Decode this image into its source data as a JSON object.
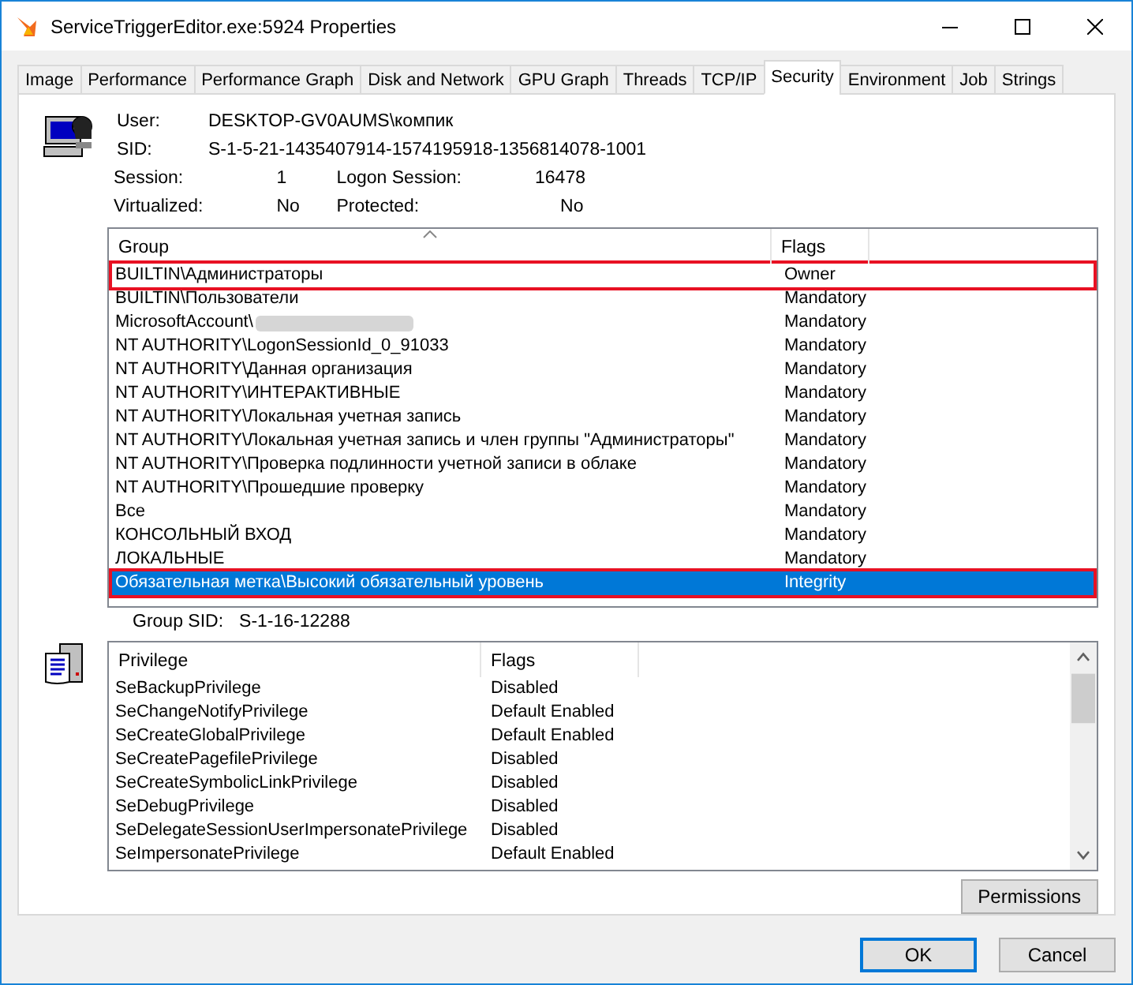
{
  "window": {
    "title": "ServiceTriggerEditor.exe:5924 Properties"
  },
  "tabs": [
    {
      "label": "Image",
      "selected": false
    },
    {
      "label": "Performance",
      "selected": false
    },
    {
      "label": "Performance Graph",
      "selected": false
    },
    {
      "label": "Disk and Network",
      "selected": false
    },
    {
      "label": "GPU Graph",
      "selected": false
    },
    {
      "label": "Threads",
      "selected": false
    },
    {
      "label": "TCP/IP",
      "selected": false
    },
    {
      "label": "Security",
      "selected": true
    },
    {
      "label": "Environment",
      "selected": false
    },
    {
      "label": "Job",
      "selected": false
    },
    {
      "label": "Strings",
      "selected": false
    }
  ],
  "user_info": {
    "user_label": "User:",
    "user": "DESKTOP-GV0AUMS\\компик",
    "sid_label": "SID:",
    "sid": "S-1-5-21-1435407914-1574195918-1356814078-1001",
    "session_label": "Session:",
    "session": "1",
    "logon_session_label": "Logon Session:",
    "logon_session": "16478",
    "virtualized_label": "Virtualized:",
    "virtualized": "No",
    "protected_label": "Protected:",
    "protected": "No"
  },
  "groups_table": {
    "columns": [
      "Group",
      "Flags"
    ],
    "rows": [
      {
        "group": "BUILTIN\\Администраторы",
        "flags": "Owner",
        "selected": false,
        "annotated": true,
        "redacted": false
      },
      {
        "group": "BUILTIN\\Пользователи",
        "flags": "Mandatory",
        "selected": false,
        "annotated": false,
        "redacted": false
      },
      {
        "group": "MicrosoftAccount\\",
        "flags": "Mandatory",
        "selected": false,
        "annotated": false,
        "redacted": true
      },
      {
        "group": "NT AUTHORITY\\LogonSessionId_0_91033",
        "flags": "Mandatory",
        "selected": false,
        "annotated": false,
        "redacted": false
      },
      {
        "group": "NT AUTHORITY\\Данная организация",
        "flags": "Mandatory",
        "selected": false,
        "annotated": false,
        "redacted": false
      },
      {
        "group": "NT AUTHORITY\\ИНТЕРАКТИВНЫЕ",
        "flags": "Mandatory",
        "selected": false,
        "annotated": false,
        "redacted": false
      },
      {
        "group": "NT AUTHORITY\\Локальная учетная запись",
        "flags": "Mandatory",
        "selected": false,
        "annotated": false,
        "redacted": false
      },
      {
        "group": "NT AUTHORITY\\Локальная учетная запись и член группы \"Администраторы\"",
        "flags": "Mandatory",
        "selected": false,
        "annotated": false,
        "redacted": false
      },
      {
        "group": "NT AUTHORITY\\Проверка подлинности учетной записи в облаке",
        "flags": "Mandatory",
        "selected": false,
        "annotated": false,
        "redacted": false
      },
      {
        "group": "NT AUTHORITY\\Прошедшие проверку",
        "flags": "Mandatory",
        "selected": false,
        "annotated": false,
        "redacted": false
      },
      {
        "group": "Все",
        "flags": "Mandatory",
        "selected": false,
        "annotated": false,
        "redacted": false
      },
      {
        "group": "КОНСОЛЬНЫЙ ВХОД",
        "flags": "Mandatory",
        "selected": false,
        "annotated": false,
        "redacted": false
      },
      {
        "group": "ЛОКАЛЬНЫЕ",
        "flags": "Mandatory",
        "selected": false,
        "annotated": false,
        "redacted": false
      },
      {
        "group": "Обязательная метка\\Высокий обязательный уровень",
        "flags": "Integrity",
        "selected": true,
        "annotated": true,
        "redacted": false
      }
    ]
  },
  "group_sid": {
    "label": "Group SID:",
    "value": "S-1-16-12288"
  },
  "privileges_table": {
    "columns": [
      "Privilege",
      "Flags"
    ],
    "rows": [
      {
        "privilege": "SeBackupPrivilege",
        "flags": "Disabled"
      },
      {
        "privilege": "SeChangeNotifyPrivilege",
        "flags": "Default Enabled"
      },
      {
        "privilege": "SeCreateGlobalPrivilege",
        "flags": "Default Enabled"
      },
      {
        "privilege": "SeCreatePagefilePrivilege",
        "flags": "Disabled"
      },
      {
        "privilege": "SeCreateSymbolicLinkPrivilege",
        "flags": "Disabled"
      },
      {
        "privilege": "SeDebugPrivilege",
        "flags": "Disabled"
      },
      {
        "privilege": "SeDelegateSessionUserImpersonatePrivilege",
        "flags": "Disabled"
      },
      {
        "privilege": "SeImpersonatePrivilege",
        "flags": "Default Enabled"
      }
    ]
  },
  "buttons": {
    "permissions": "Permissions",
    "ok": "OK",
    "cancel": "Cancel"
  }
}
